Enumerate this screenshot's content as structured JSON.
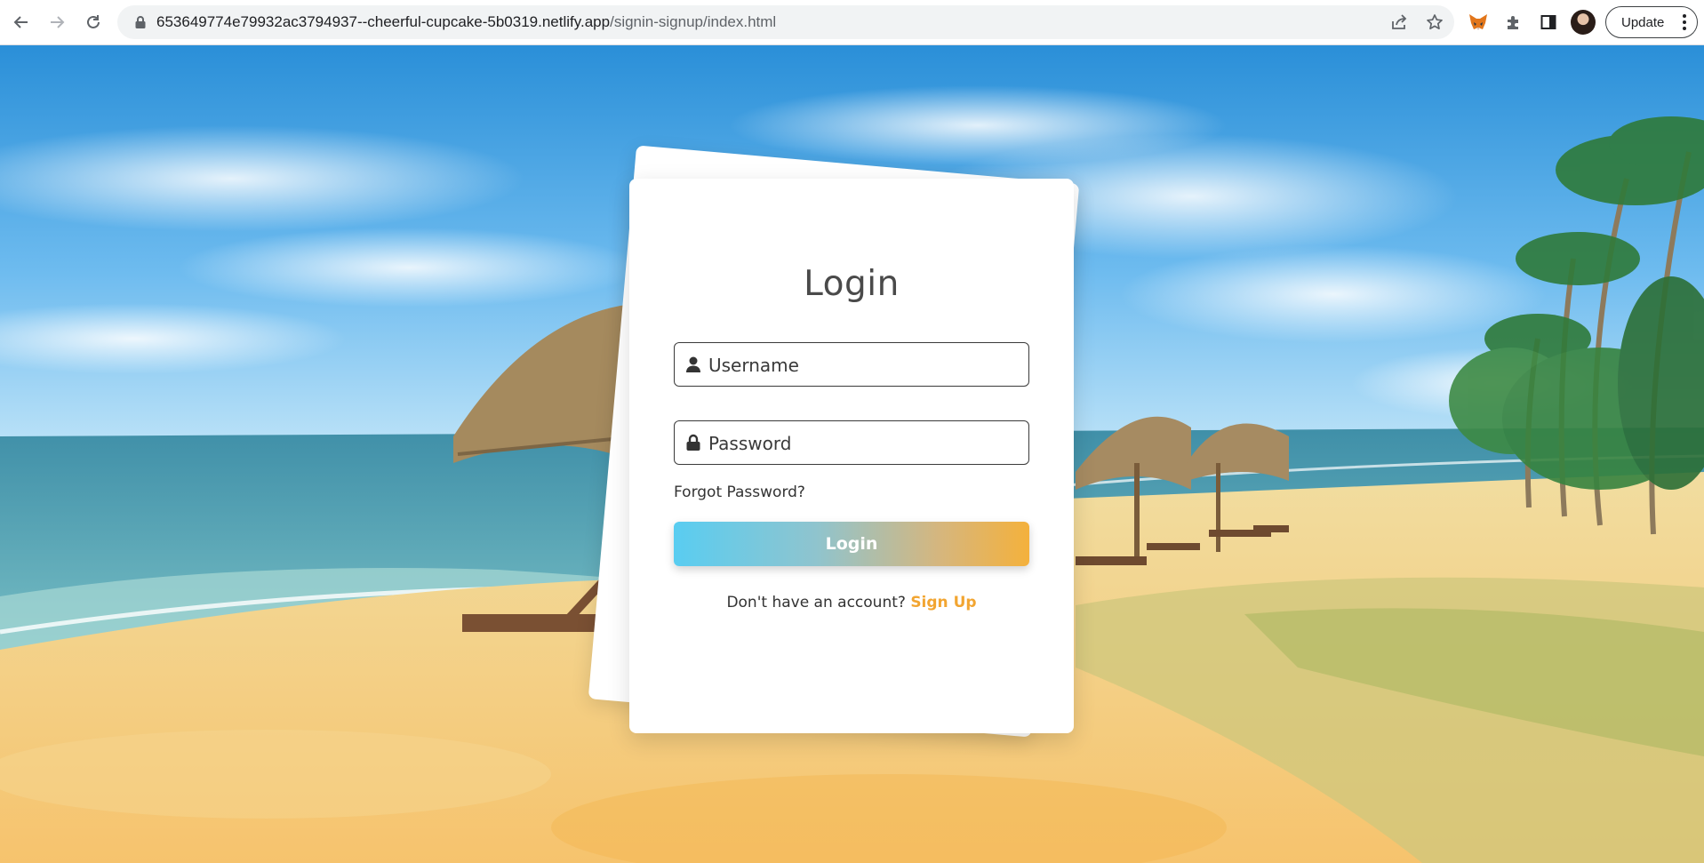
{
  "browser": {
    "url_host": "653649774e79932ac3794937--cheerful-cupcake-5b0319.netlify.app",
    "url_path": "/signin-signup/index.html",
    "update_label": "Update"
  },
  "login": {
    "title": "Login",
    "username_placeholder": "Username",
    "password_placeholder": "Password",
    "forgot_label": "Forgot Password?",
    "button_label": "Login",
    "signup_prompt": "Don't have an account?",
    "signup_link": "Sign Up"
  },
  "colors": {
    "accent_orange": "#f2a531",
    "gradient_start": "#59cdf1",
    "gradient_end": "#f4b13c"
  }
}
